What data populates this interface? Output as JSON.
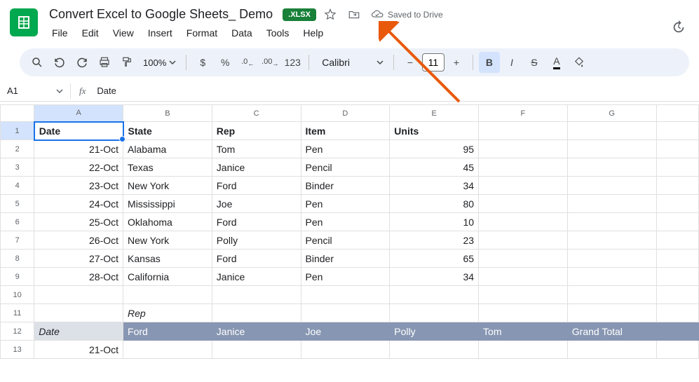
{
  "doc": {
    "title": "Convert Excel to Google Sheets_ Demo",
    "badge": ".XLSX",
    "saved": "Saved to Drive"
  },
  "menu": [
    "File",
    "Edit",
    "View",
    "Insert",
    "Format",
    "Data",
    "Tools",
    "Help"
  ],
  "toolbar": {
    "zoom": "100%",
    "currency": "$",
    "percent": "%",
    "dec_dec": ".0",
    "inc_dec": ".00",
    "fmt123": "123",
    "font": "Calibri",
    "size": "11"
  },
  "formula": {
    "cell_ref": "A1",
    "fx": "fx",
    "value": "Date"
  },
  "columns": [
    "A",
    "B",
    "C",
    "D",
    "E",
    "F",
    "G",
    ""
  ],
  "rows": [
    1,
    2,
    3,
    4,
    5,
    6,
    7,
    8,
    9,
    10,
    11,
    12,
    13
  ],
  "chart_data": {
    "type": "table",
    "headers": [
      "Date",
      "State",
      "Rep",
      "Item",
      "Units"
    ],
    "records": [
      {
        "date": "21-Oct",
        "state": "Alabama",
        "rep": "Tom",
        "item": "Pen",
        "units": 95
      },
      {
        "date": "22-Oct",
        "state": "Texas",
        "rep": "Janice",
        "item": "Pencil",
        "units": 45
      },
      {
        "date": "23-Oct",
        "state": "New York",
        "rep": "Ford",
        "item": "Binder",
        "units": 34
      },
      {
        "date": "24-Oct",
        "state": "Mississippi",
        "rep": "Joe",
        "item": "Pen",
        "units": 80
      },
      {
        "date": "25-Oct",
        "state": "Oklahoma",
        "rep": "Ford",
        "item": "Pen",
        "units": 10
      },
      {
        "date": "26-Oct",
        "state": "New York",
        "rep": "Polly",
        "item": "Pencil",
        "units": 23
      },
      {
        "date": "27-Oct",
        "state": "Kansas",
        "rep": "Ford",
        "item": "Binder",
        "units": 65
      },
      {
        "date": "28-Oct",
        "state": "California",
        "rep": "Janice",
        "item": "Pen",
        "units": 34
      }
    ],
    "pivot": {
      "label_rep": "Rep",
      "label_date": "Date",
      "cols": [
        "Ford",
        "Janice",
        "Joe",
        "Polly",
        "Tom",
        "Grand Total"
      ],
      "row1_date": "21-Oct"
    }
  }
}
